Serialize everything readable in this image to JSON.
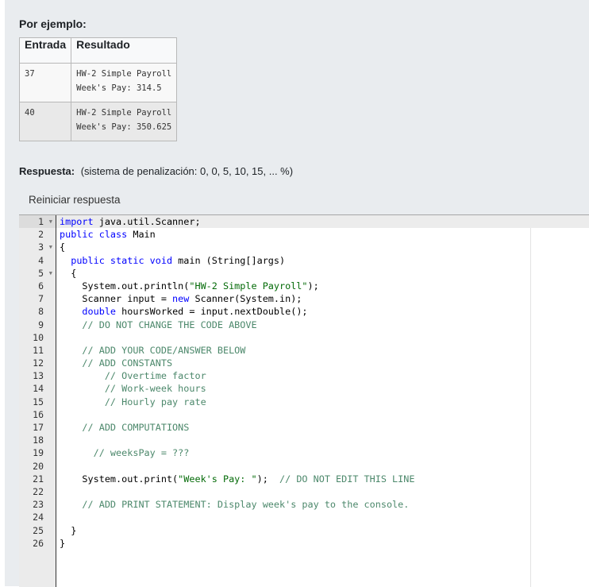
{
  "examples": {
    "title": "Por ejemplo:",
    "headers": [
      "Entrada",
      "Resultado"
    ],
    "rows": [
      {
        "input": "37",
        "output": [
          "HW-2 Simple Payroll",
          "Week's Pay: 314.5"
        ]
      },
      {
        "input": "40",
        "output": [
          "HW-2 Simple Payroll",
          "Week's Pay: 350.625"
        ]
      }
    ]
  },
  "answer": {
    "label": "Respuesta:",
    "penalty": "(sistema de penalización: 0, 0, 5, 10, 15, ... %)",
    "reset_button": "Reiniciar respuesta"
  },
  "editor": {
    "active_line": 1,
    "fold_lines": [
      1,
      3,
      5
    ],
    "lines": [
      [
        {
          "t": "kw",
          "v": "import"
        },
        {
          "t": "ident",
          "v": " java.util.Scanner;"
        }
      ],
      [
        {
          "t": "kw",
          "v": "public class"
        },
        {
          "t": "ident",
          "v": " Main"
        }
      ],
      [
        {
          "t": "ident",
          "v": "{"
        }
      ],
      [
        {
          "t": "ident",
          "v": "  "
        },
        {
          "t": "kw",
          "v": "public static void"
        },
        {
          "t": "ident",
          "v": " main (String[]args)"
        }
      ],
      [
        {
          "t": "ident",
          "v": "  {"
        }
      ],
      [
        {
          "t": "ident",
          "v": "    System.out.println("
        },
        {
          "t": "str",
          "v": "\"HW-2 Simple Payroll\""
        },
        {
          "t": "ident",
          "v": ");"
        }
      ],
      [
        {
          "t": "ident",
          "v": "    Scanner input = "
        },
        {
          "t": "kw",
          "v": "new"
        },
        {
          "t": "ident",
          "v": " Scanner(System.in);"
        }
      ],
      [
        {
          "t": "ident",
          "v": "    "
        },
        {
          "t": "kw",
          "v": "double"
        },
        {
          "t": "ident",
          "v": " hoursWorked = input.nextDouble();"
        }
      ],
      [
        {
          "t": "ident",
          "v": "    "
        },
        {
          "t": "cm",
          "v": "// DO NOT CHANGE THE CODE ABOVE"
        }
      ],
      [
        {
          "t": "ident",
          "v": ""
        }
      ],
      [
        {
          "t": "ident",
          "v": "    "
        },
        {
          "t": "cm",
          "v": "// ADD YOUR CODE/ANSWER BELOW"
        }
      ],
      [
        {
          "t": "ident",
          "v": "    "
        },
        {
          "t": "cm",
          "v": "// ADD CONSTANTS"
        }
      ],
      [
        {
          "t": "ident",
          "v": "        "
        },
        {
          "t": "cm",
          "v": "// Overtime factor"
        }
      ],
      [
        {
          "t": "ident",
          "v": "        "
        },
        {
          "t": "cm",
          "v": "// Work-week hours"
        }
      ],
      [
        {
          "t": "ident",
          "v": "        "
        },
        {
          "t": "cm",
          "v": "// Hourly pay rate"
        }
      ],
      [
        {
          "t": "ident",
          "v": ""
        }
      ],
      [
        {
          "t": "ident",
          "v": "    "
        },
        {
          "t": "cm",
          "v": "// ADD COMPUTATIONS"
        }
      ],
      [
        {
          "t": "ident",
          "v": ""
        }
      ],
      [
        {
          "t": "ident",
          "v": "      "
        },
        {
          "t": "cm",
          "v": "// weeksPay = ???"
        }
      ],
      [
        {
          "t": "ident",
          "v": ""
        }
      ],
      [
        {
          "t": "ident",
          "v": "    System.out.print("
        },
        {
          "t": "str",
          "v": "\"Week's Pay: \""
        },
        {
          "t": "ident",
          "v": ");  "
        },
        {
          "t": "cm",
          "v": "// DO NOT EDIT THIS LINE"
        }
      ],
      [
        {
          "t": "ident",
          "v": ""
        }
      ],
      [
        {
          "t": "ident",
          "v": "    "
        },
        {
          "t": "cm",
          "v": "// ADD PRINT STATEMENT: Display week's pay to the console."
        }
      ],
      [
        {
          "t": "ident",
          "v": ""
        }
      ],
      [
        {
          "t": "ident",
          "v": "  }"
        }
      ],
      [
        {
          "t": "ident",
          "v": "}"
        }
      ]
    ]
  }
}
